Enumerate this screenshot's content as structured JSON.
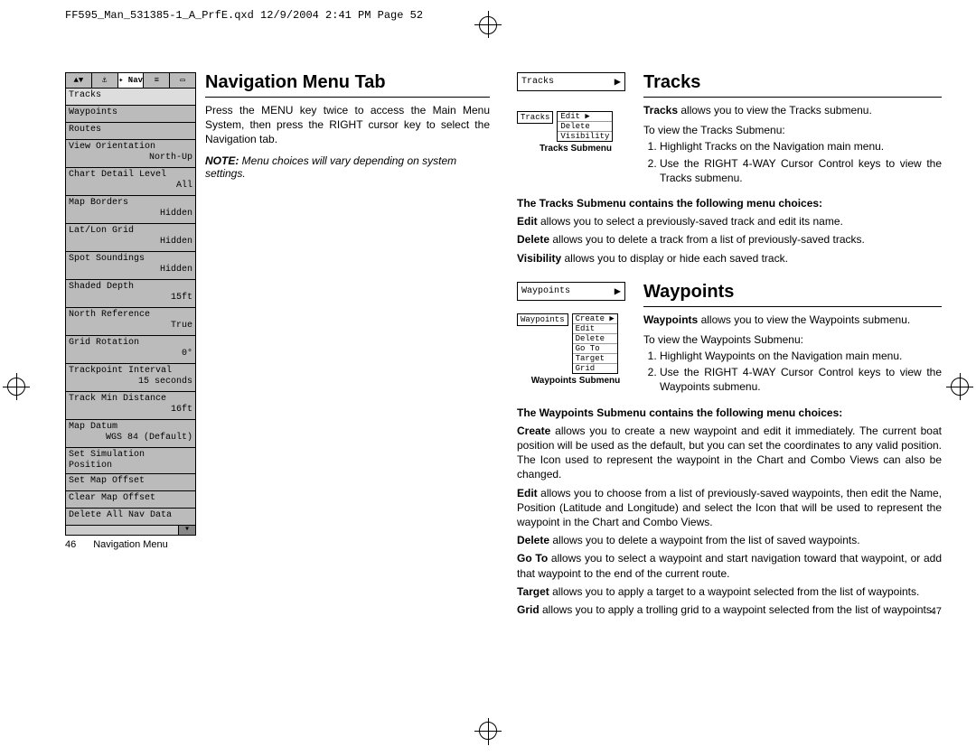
{
  "header": "FF595_Man_531385-1_A_PrfE.qxd  12/9/2004  2:41 PM  Page 52",
  "left": {
    "nav_tabs": [
      "▲▼",
      "⚓",
      "✦ Nav",
      "≡",
      "▭"
    ],
    "active_tab_index": 2,
    "menu_items": [
      {
        "label": "Tracks",
        "value": "",
        "hl": true
      },
      {
        "label": "Waypoints",
        "value": ""
      },
      {
        "label": "Routes",
        "value": ""
      },
      {
        "label": "View Orientation",
        "value": "North-Up"
      },
      {
        "label": "Chart Detail Level",
        "value": "All"
      },
      {
        "label": "Map Borders",
        "value": "Hidden"
      },
      {
        "label": "Lat/Lon Grid",
        "value": "Hidden"
      },
      {
        "label": "Spot Soundings",
        "value": "Hidden"
      },
      {
        "label": "Shaded Depth",
        "value": "15ft"
      },
      {
        "label": "North Reference",
        "value": "True"
      },
      {
        "label": "Grid Rotation",
        "value": "0°"
      },
      {
        "label": "Trackpoint Interval",
        "value": "15 seconds"
      },
      {
        "label": "Track Min Distance",
        "value": "16ft"
      },
      {
        "label": "Map Datum",
        "value": "WGS 84 (Default)"
      },
      {
        "label": "Set Simulation Position",
        "value": ""
      },
      {
        "label": "Set Map Offset",
        "value": ""
      },
      {
        "label": "Clear Map Offset",
        "value": ""
      },
      {
        "label": "Delete All Nav Data",
        "value": ""
      }
    ],
    "nav_caption": "Navigation Menu",
    "title": "Navigation Menu Tab",
    "para": "Press the MENU key twice to access the Main Menu System, then press the RIGHT cursor key to select the Navigation tab.",
    "note_label": "NOTE:",
    "note_text": " Menu choices will vary depending on system settings.",
    "pagenum": "46"
  },
  "right": {
    "tracks": {
      "box_label": "Tracks",
      "title": "Tracks",
      "intro_bold": "Tracks",
      "intro_rest": " allows you to view the Tracks submenu.",
      "toview": "To view the Tracks Submenu:",
      "sub_label": "Tracks",
      "sub_opts": [
        "Edit    ▶",
        "Delete",
        "Visibility"
      ],
      "sub_caption": "Tracks Submenu",
      "steps": [
        "Highlight Tracks on the Navigation main menu.",
        "Use the RIGHT 4-WAY Cursor Control keys to view the Tracks submenu."
      ],
      "choices_head": "The Tracks Submenu contains the following menu choices:",
      "edit_b": "Edit",
      "edit_t": " allows you to select a previously-saved track and edit its name.",
      "delete_b": "Delete",
      "delete_t": " allows you to delete a track from a list of previously-saved tracks.",
      "vis_b": "Visibility",
      "vis_t": " allows you to display or hide each saved track."
    },
    "waypoints": {
      "box_label": "Waypoints",
      "title": "Waypoints",
      "intro_bold": "Waypoints",
      "intro_rest": " allows you to view the Waypoints submenu.",
      "toview": "To view the Waypoints Submenu:",
      "sub_label": "Waypoints",
      "sub_opts": [
        "Create ▶",
        "Edit",
        "Delete",
        "Go To",
        "Target",
        "Grid"
      ],
      "sub_caption": "Waypoints Submenu",
      "steps": [
        "Highlight Waypoints on the Navigation main menu.",
        "Use the RIGHT 4-WAY Cursor Control keys to view the Waypoints submenu."
      ],
      "choices_head": "The Waypoints Submenu contains the following menu choices:",
      "create_b": "Create",
      "create_t": " allows you to create a new waypoint and edit it immediately.  The current boat position will be used as the default, but you can set the coordinates to any valid position. The Icon used to represent the waypoint in the Chart and Combo Views can also be changed.",
      "edit_b": "Edit",
      "edit_t": " allows you to choose from a list of previously-saved waypoints, then edit the Name, Position (Latitude and Longitude) and select the Icon that will be used to represent the waypoint in the Chart and Combo Views.",
      "delete_b": "Delete",
      "delete_t": " allows you to delete a waypoint from the list of saved waypoints.",
      "goto_b": "Go To",
      "goto_t": " allows you to select a waypoint and start navigation toward that waypoint, or add that waypoint to the end of the current route.",
      "target_b": "Target",
      "target_t": " allows you to apply a target to a waypoint selected from the list of waypoints.",
      "grid_b": "Grid",
      "grid_t": " allows you to apply a trolling grid to a waypoint selected from the list of waypoints."
    },
    "pagenum": "47"
  }
}
